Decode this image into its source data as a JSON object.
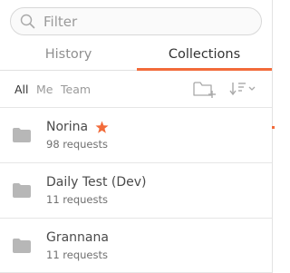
{
  "search": {
    "placeholder": "Filter",
    "value": ""
  },
  "tabs": [
    {
      "label": "History",
      "active": false
    },
    {
      "label": "Collections",
      "active": true
    }
  ],
  "filters": {
    "all": "All",
    "me": "Me",
    "team": "Team",
    "selected": "All"
  },
  "toolbar": {
    "new_folder_icon": "new-folder-icon",
    "sort_icon": "sort-icon"
  },
  "collections": [
    {
      "name": "Norina",
      "requests": "98 requests",
      "starred": true
    },
    {
      "name": "Daily Test (Dev)",
      "requests": "11 requests",
      "starred": false
    },
    {
      "name": "Grannana",
      "requests": "11 requests",
      "starred": false
    }
  ],
  "colors": {
    "accent": "#f26b3a",
    "icon_gray": "#b3b3b3"
  }
}
